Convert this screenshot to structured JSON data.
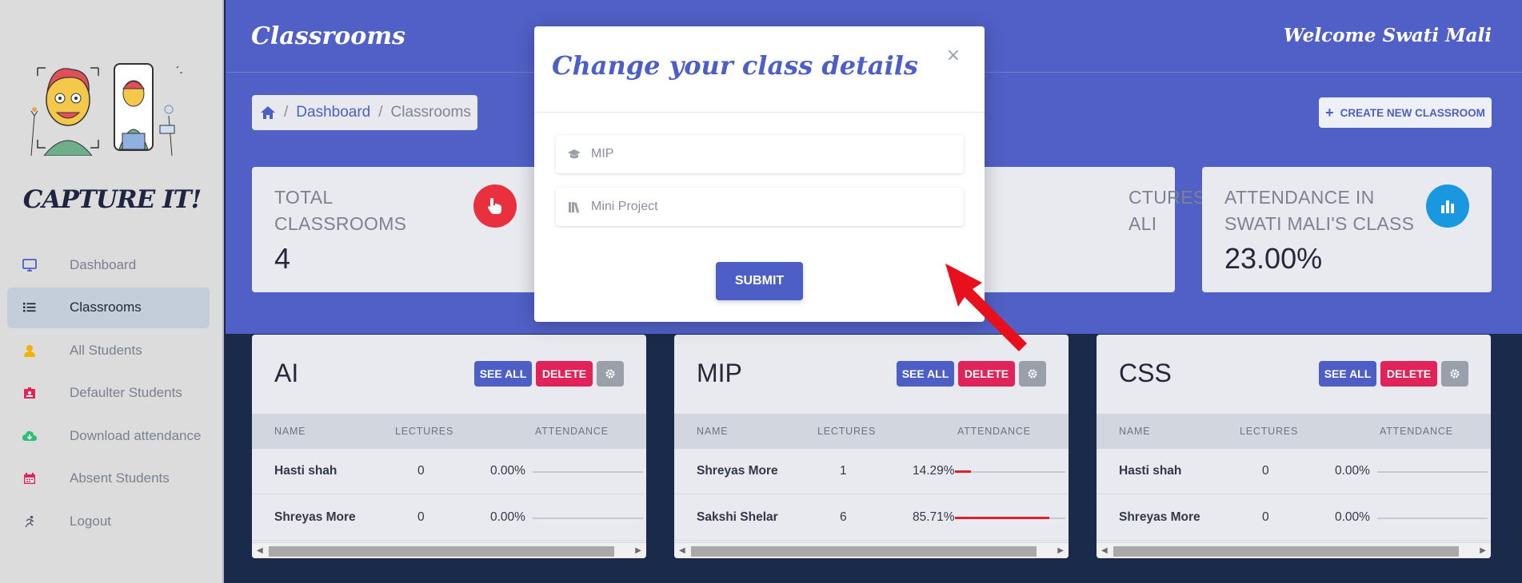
{
  "app": {
    "brand": "CAPTURE IT!",
    "header_title": "Classrooms",
    "welcome": "Welcome Swati Mali"
  },
  "sidebar": {
    "items": [
      {
        "label": "Dashboard",
        "icon": "monitor-icon",
        "color": "#4d5fc7",
        "active": false
      },
      {
        "label": "Classrooms",
        "icon": "list-icon",
        "color": "#25283a",
        "active": true
      },
      {
        "label": "All Students",
        "icon": "user-icon",
        "color": "#f0b400",
        "active": false
      },
      {
        "label": "Defaulter Students",
        "icon": "id-card-icon",
        "color": "#e0245a",
        "active": false
      },
      {
        "label": "Download attendance",
        "icon": "cloud-download-icon",
        "color": "#2dbf77",
        "active": false
      },
      {
        "label": "Absent Students",
        "icon": "calendar-icon",
        "color": "#e0245a",
        "active": false
      },
      {
        "label": "Logout",
        "icon": "running-icon",
        "color": "#555b6a",
        "active": false
      }
    ]
  },
  "breadcrumb": {
    "home_icon": "home-icon",
    "items": [
      "Dashboard",
      "Classrooms"
    ]
  },
  "create_button": {
    "label": "CREATE NEW CLASSROOM",
    "icon": "plus-icon"
  },
  "stats": [
    {
      "label_line1": "TOTAL",
      "label_line2": "CLASSROOMS",
      "value": "4",
      "icon": "hand-pointer-icon",
      "color": "#e8303f"
    },
    {
      "label_line1": "CTURES BY",
      "label_line2": "ALI",
      "value": "",
      "icon": "coins-icon",
      "color": "#2dbf8f"
    },
    {
      "label_line1": "ATTENDANCE IN",
      "label_line2": "SWATI MALI'S CLASS",
      "value": "23.00%",
      "icon": "chart-bar-icon",
      "color": "#1998e0"
    }
  ],
  "table_headers": {
    "name": "NAME",
    "lectures": "LECTURES",
    "attendance": "ATTENDANCE"
  },
  "classrooms": [
    {
      "title": "AI",
      "see_all": "SEE ALL",
      "delete": "DELETE",
      "rows": [
        {
          "name": "Hasti shah",
          "lectures": "0",
          "attendance": "0.00%",
          "fraction": 0
        },
        {
          "name": "Shreyas More",
          "lectures": "0",
          "attendance": "0.00%",
          "fraction": 0
        }
      ]
    },
    {
      "title": "MIP",
      "see_all": "SEE ALL",
      "delete": "DELETE",
      "rows": [
        {
          "name": "Shreyas More",
          "lectures": "1",
          "attendance": "14.29%",
          "fraction": 0.1429
        },
        {
          "name": "Sakshi Shelar",
          "lectures": "6",
          "attendance": "85.71%",
          "fraction": 0.8571
        }
      ]
    },
    {
      "title": "CSS",
      "see_all": "SEE ALL",
      "delete": "DELETE",
      "rows": [
        {
          "name": "Hasti shah",
          "lectures": "0",
          "attendance": "0.00%",
          "fraction": 0
        },
        {
          "name": "Shreyas More",
          "lectures": "0",
          "attendance": "0.00%",
          "fraction": 0
        }
      ]
    }
  ],
  "modal": {
    "title": "Change your class details",
    "close": "×",
    "class_name_value": "MIP",
    "class_name_icon": "graduation-cap-icon",
    "subject_value": "Mini Project",
    "subject_icon": "books-icon",
    "submit": "SUBMIT"
  },
  "colors": {
    "primary": "#4d5fc7",
    "header_bg": "#5160c6",
    "danger": "#e0245a",
    "annotation_arrow": "#e8101c"
  }
}
